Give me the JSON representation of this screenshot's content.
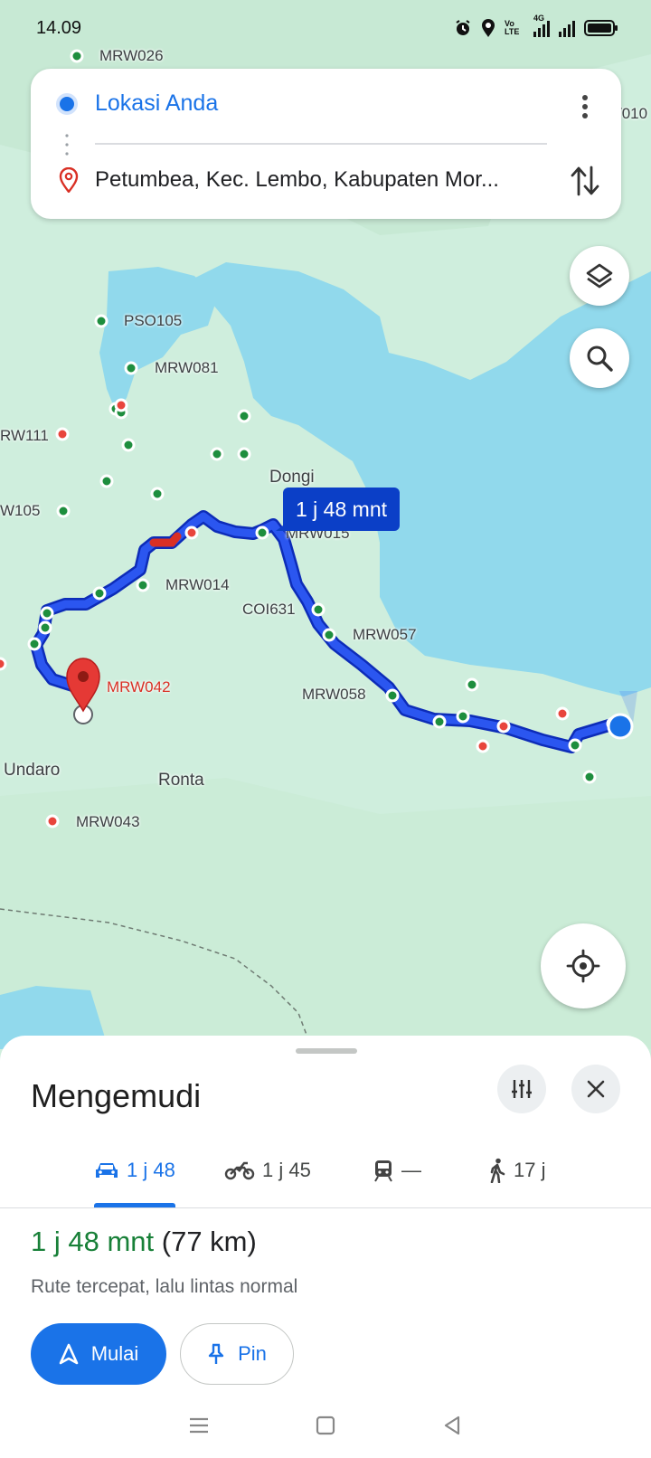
{
  "status_bar": {
    "time": "14.09",
    "icons": [
      "alarm-icon",
      "location-icon",
      "volte-icon",
      "4g-signal-icon",
      "signal-icon",
      "battery-icon"
    ],
    "volte_text": "Vo LTE",
    "network_text": "4G"
  },
  "directions": {
    "origin": "Lokasi Anda",
    "destination": "Petumbea, Kec. Lembo, Kabupaten Mor..."
  },
  "map": {
    "eta_bubble": "1 j 48 mnt",
    "labels": {
      "mrw026": "MRW026",
      "w010": "/010",
      "pso105": "PSO105",
      "mrw081": "MRW081",
      "rw111": "RW111",
      "dongi": "Dongi",
      "w105": "W105",
      "mrw015": "MRW015",
      "mrw014": "MRW014",
      "coi631": "COI631",
      "mrw057": "MRW057",
      "mrw042": "MRW042",
      "mrw058": "MRW058",
      "undaro": "Undaro",
      "ronta": "Ronta",
      "mrw043": "MRW043"
    }
  },
  "sheet": {
    "title": "Mengemudi",
    "modes": [
      {
        "icon": "car-icon",
        "label": "1 j 48"
      },
      {
        "icon": "motorcycle-icon",
        "label": "1 j 45"
      },
      {
        "icon": "train-icon",
        "label": "—"
      },
      {
        "icon": "walk-icon",
        "label": "17 j"
      }
    ],
    "route_time": "1 j 48 mnt",
    "route_distance": "(77 km)",
    "route_description": "Rute tercepat, lalu lintas normal",
    "start_label": "Mulai",
    "pin_label": "Pin"
  },
  "colors": {
    "route_blue": "#1a3fe0",
    "eta_blue": "#0b3fc7",
    "accent": "#1a73e8",
    "green_time": "#188038",
    "water": "#91d9ec",
    "land": "#cfeedd",
    "dest_red": "#e53935"
  }
}
